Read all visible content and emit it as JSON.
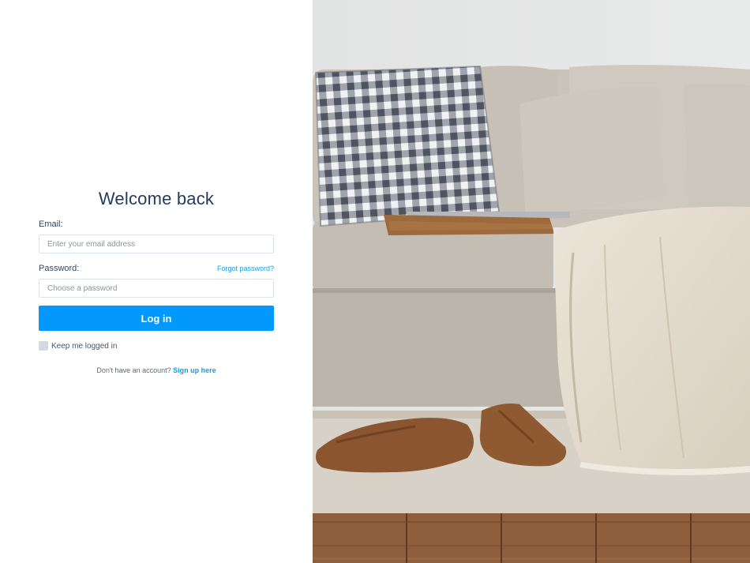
{
  "login": {
    "title": "Welcome back",
    "email_label": "Email:",
    "email_placeholder": "Enter your email address",
    "email_value": "",
    "password_label": "Password:",
    "forgot_password": "Forgot password?",
    "password_placeholder": "Choose a password",
    "password_value": "",
    "login_button": "Log in",
    "remember_label": "Keep me logged in",
    "remember_checked": false,
    "signup_prompt": "Don't have an account?",
    "signup_link": "Sign up here"
  },
  "colors": {
    "accent": "#0399fc",
    "title": "#243b5c",
    "link": "#1a9be0"
  },
  "icons": {
    "photo": "living-room-sofa-photo"
  }
}
